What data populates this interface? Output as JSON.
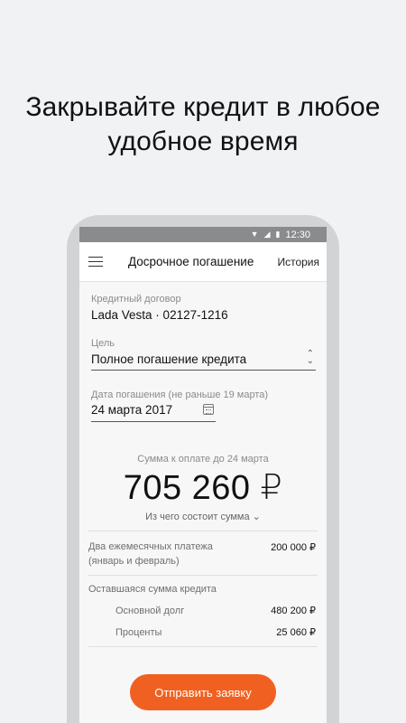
{
  "promo": {
    "line1": "Закрывайте кредит в любое",
    "line2": "удобное время"
  },
  "status_bar": {
    "time": "12:30",
    "icons": [
      "wifi-icon",
      "signal-icon",
      "battery-icon"
    ]
  },
  "app_bar": {
    "title": "Досрочное погашение",
    "history": "История",
    "menu_icon": "hamburger-menu-icon"
  },
  "contract": {
    "label": "Кредитный договор",
    "value": "Lada Vesta · 02127-1216"
  },
  "goal": {
    "label": "Цель",
    "value": "Полное погашение кредита"
  },
  "date": {
    "label": "Дата погашения (не раньше 19 марта)",
    "value": "24 марта 2017"
  },
  "summary": {
    "caption": "Сумма к оплате до 24 марта",
    "amount": "705 260 ₽",
    "breakdown_link": "Из чего состоит сумма ⌄"
  },
  "payments": {
    "label_line1": "Два ежемесячных платежа",
    "label_line2": "(январь и февраль)",
    "amount": "200 000 ₽"
  },
  "remaining": {
    "label": "Оставшаяся сумма кредита",
    "items": [
      {
        "label": "Основной долг",
        "amount": "480 200 ₽"
      },
      {
        "label": "Проценты",
        "amount": "25 060 ₽"
      }
    ]
  },
  "submit_label": "Отправить заявку",
  "colors": {
    "accent": "#f06121",
    "background": "#f1f2f4",
    "phone_frame": "#d2d3d5",
    "status_bar": "#8a8b8d"
  }
}
